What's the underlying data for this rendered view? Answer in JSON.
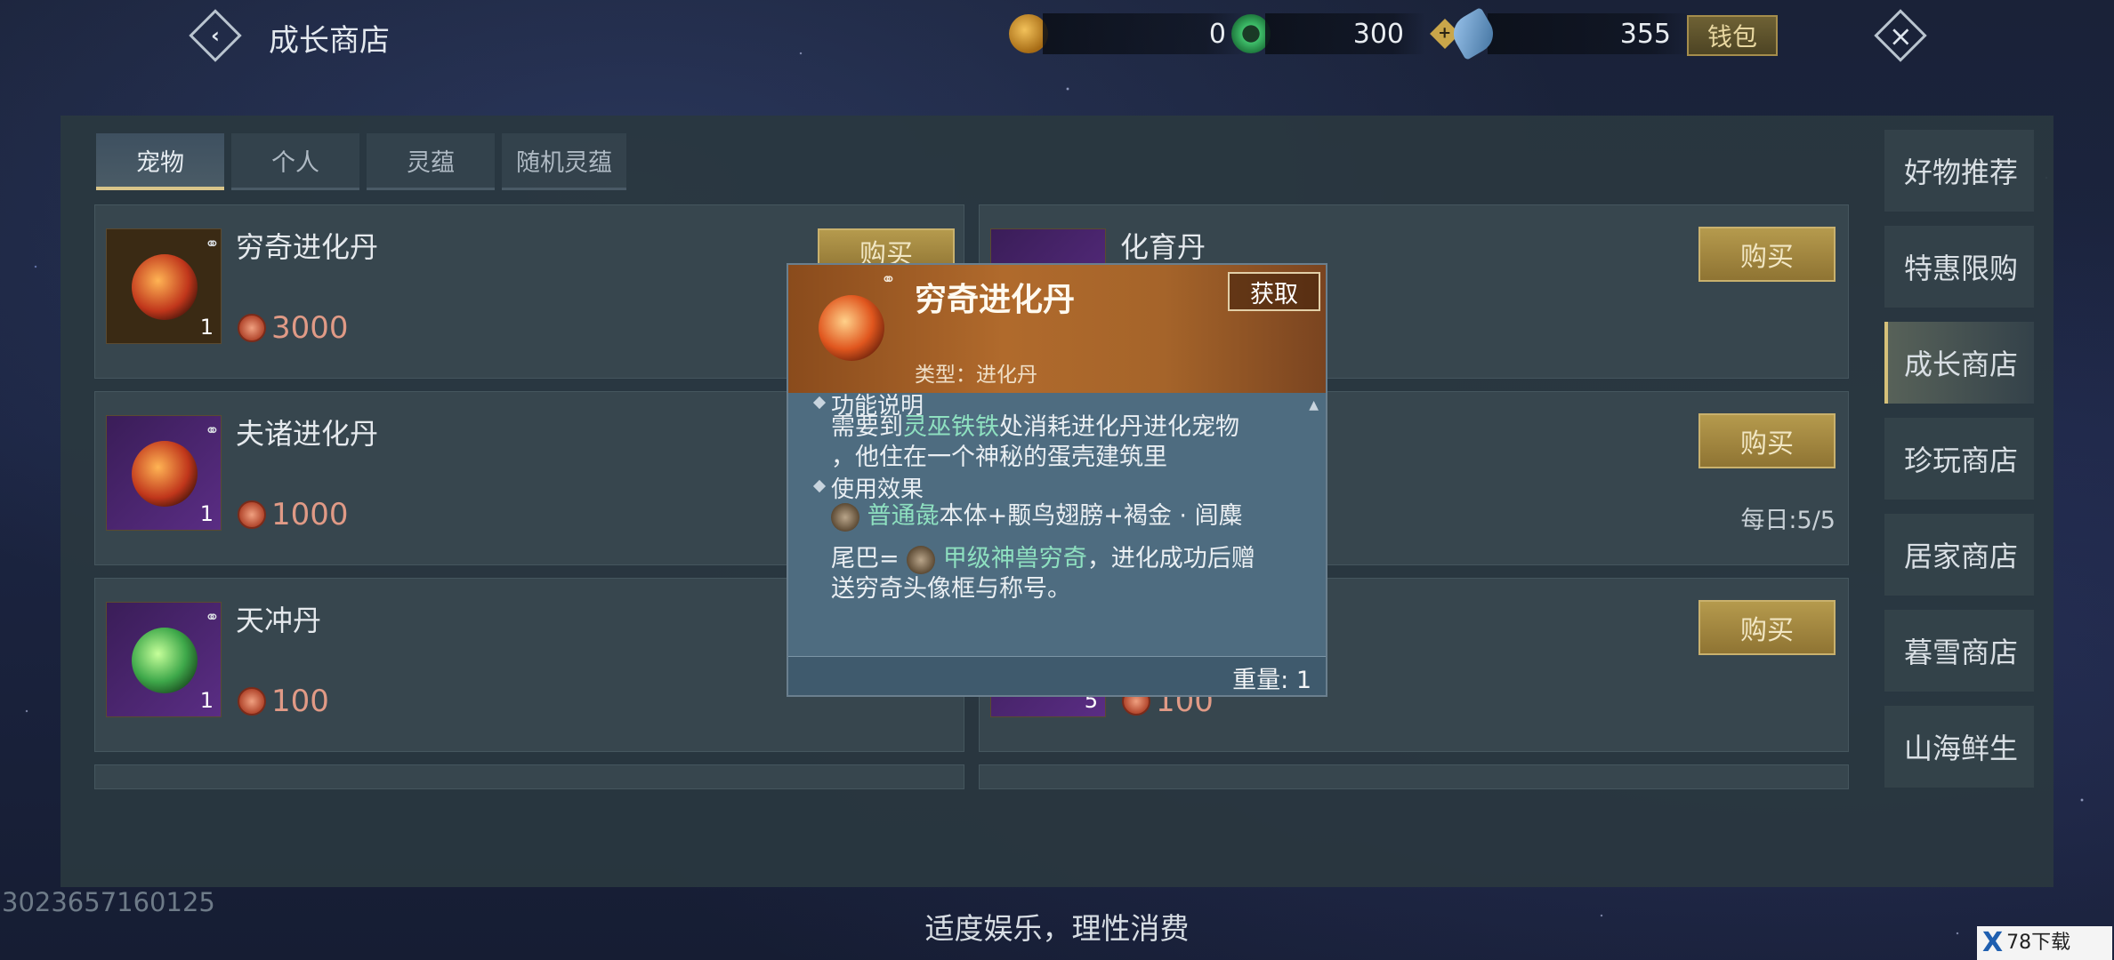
{
  "header": {
    "title": "成长商店",
    "wallet_label": "钱包"
  },
  "currencies": [
    {
      "icon": "gourd-coin-icon",
      "value": "0"
    },
    {
      "icon": "jade-ring-icon",
      "value": "300"
    },
    {
      "icon": "feather-crystal-icon",
      "value": "355"
    }
  ],
  "tabs": [
    "宠物",
    "个人",
    "灵蕴",
    "随机灵蕴"
  ],
  "items": [
    {
      "name": "穷奇进化丹",
      "qty": "1",
      "price": "3000"
    },
    {
      "name": "化育丹",
      "buy": "购买"
    },
    {
      "name": "夫诸进化丹",
      "qty": "1",
      "price": "1000"
    },
    {
      "buy": "购买",
      "daily": "每日:5/5"
    },
    {
      "name": "天冲丹",
      "qty": "1",
      "price": "100"
    },
    {
      "qty": "5",
      "price": "100",
      "buy": "购买"
    }
  ],
  "left_buy_label": "购买",
  "sidenav": [
    "好物推荐",
    "特惠限购",
    "成长商店",
    "珍玩商店",
    "居家商店",
    "暮雪商店",
    "山海鲜生"
  ],
  "tooltip": {
    "name": "穷奇进化丹",
    "get_label": "获取",
    "type": "类型：进化丹",
    "desc_title": "功能说明",
    "desc_1": "需要到",
    "desc_hl": "灵巫铁铁",
    "desc_2": "处消耗进化丹进化宠物",
    "desc_3": "，他住在一个神秘的蛋壳建筑里",
    "effect_title": "使用效果",
    "effect_hl1": "普通彘",
    "effect_1": "本体+颙鸟翅膀+褐金 · 闾麋",
    "effect_2": "尾巴=",
    "effect_hl2": "甲级神兽穷奇",
    "effect_3": "，进化成功后赠",
    "effect_4": "送穷奇头像框与称号。",
    "weight": "重量: 1"
  },
  "footer_note": "适度娱乐，理性消费",
  "uid": "3023657160125",
  "watermark": {
    "logo": "X",
    "text": "78下载"
  },
  "colors": {
    "accent_gold": "#b59a4d",
    "highlight_teal": "#8ee0c0",
    "price_red": "#e09a86"
  }
}
